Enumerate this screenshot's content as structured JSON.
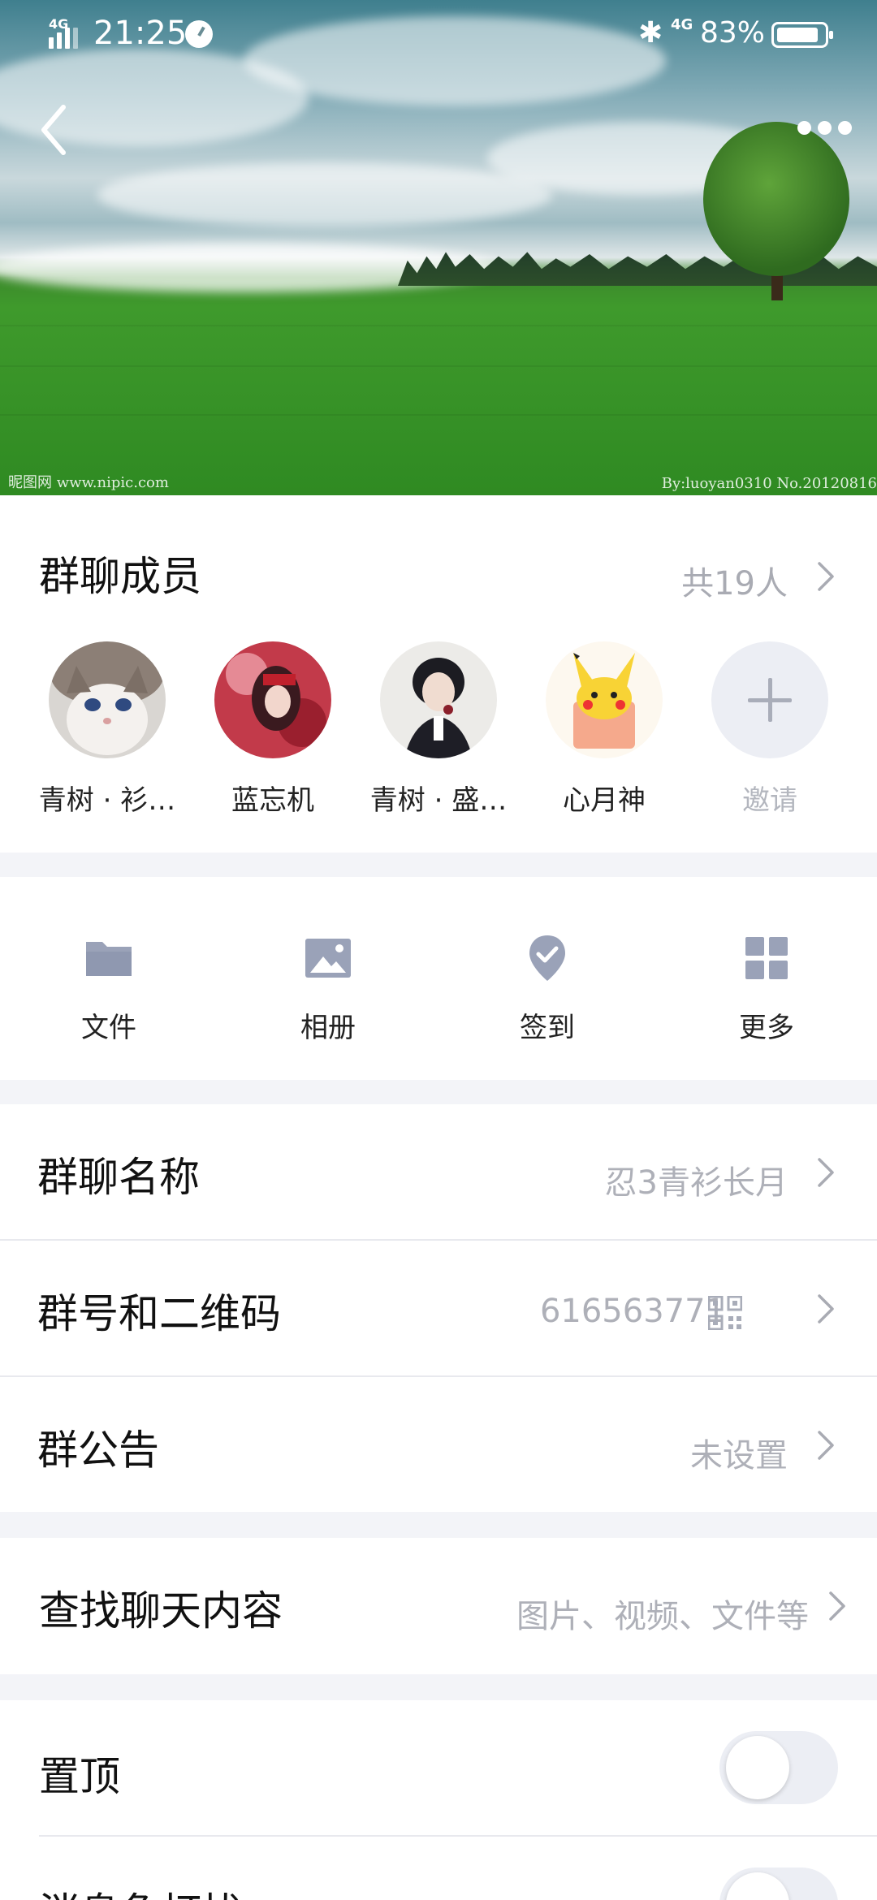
{
  "status_bar": {
    "network_left": "4G",
    "time": "21:25",
    "network_right": "4G",
    "battery": "83%"
  },
  "hero": {
    "watermark_left": "昵图网 www.nipic.com",
    "watermark_right": "By:luoyan0310  No.20120816"
  },
  "members": {
    "title": "群聊成员",
    "count": "共19人",
    "list": [
      {
        "name": "青树 · 衫…"
      },
      {
        "name": "蓝忘机"
      },
      {
        "name": "青树 · 盛…"
      },
      {
        "name": "心月神"
      }
    ],
    "invite_label": "邀请"
  },
  "tools": [
    {
      "label": "文件",
      "icon": "folder-icon"
    },
    {
      "label": "相册",
      "icon": "image-icon"
    },
    {
      "label": "签到",
      "icon": "checkin-icon"
    },
    {
      "label": "更多",
      "icon": "grid-icon"
    }
  ],
  "info": {
    "group_name": {
      "label": "群聊名称",
      "value": "忍3青衫长月"
    },
    "group_number": {
      "label": "群号和二维码",
      "value": "616563771"
    },
    "announcement": {
      "label": "群公告",
      "value": "未设置"
    }
  },
  "search": {
    "label": "查找聊天内容",
    "value": "图片、视频、文件等"
  },
  "toggles": {
    "pin": {
      "label": "置顶",
      "on": false
    },
    "dnd": {
      "label": "消息免打扰",
      "on": false
    }
  }
}
